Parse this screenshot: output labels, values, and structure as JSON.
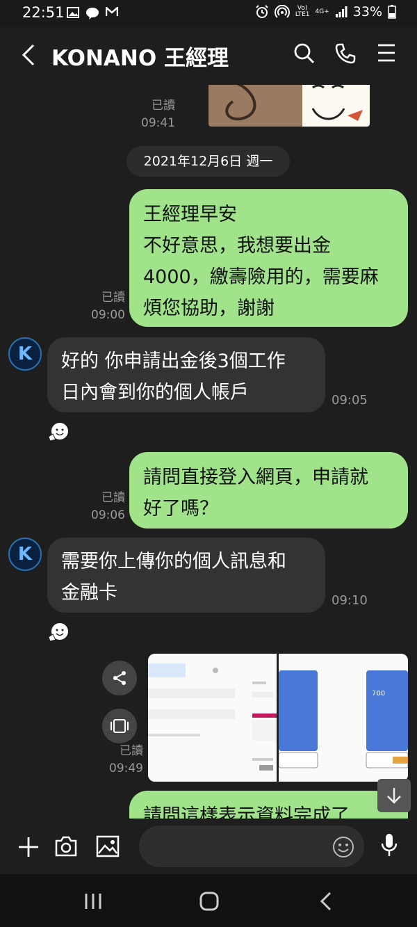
{
  "status_bar": {
    "time": "22:51",
    "volte": "Vo)",
    "lte_label": "LTE1",
    "network": "4G+",
    "battery": "33%"
  },
  "header": {
    "title": "KONANO 王經理",
    "icons": [
      "back-icon",
      "search-icon",
      "phone-icon",
      "menu-icon"
    ]
  },
  "chat": {
    "date_separator": "2021年12月6日 週一",
    "sticker_meta": {
      "read": "已讀",
      "time": "09:41"
    },
    "messages": [
      {
        "direction": "out",
        "lines": [
          "王經理早安",
          "不好意思，我想要出金",
          "4000，繳壽險用的，需要麻",
          "煩您協助，謝謝"
        ],
        "read": "已讀",
        "time": "09:00"
      },
      {
        "direction": "in",
        "avatar_letter": "K",
        "lines": [
          "好的 你申請出金後3個工作",
          "日內會到你的個人帳戶"
        ],
        "time": "09:05",
        "reaction": "smile-emoji"
      },
      {
        "direction": "out",
        "lines": [
          "請問直接登入網頁，申請就",
          "好了嗎？"
        ],
        "read": "已讀",
        "time": "09:06"
      },
      {
        "direction": "in",
        "avatar_letter": "K",
        "lines": [
          "需要你上傳你的個人訊息和",
          "金融卡"
        ],
        "time": "09:10",
        "reaction": "smile-emoji"
      },
      {
        "direction": "out",
        "type": "images",
        "read": "已讀",
        "time": "09:49",
        "image_text": "700"
      },
      {
        "direction": "out",
        "lines": [
          "請問這樣表示資料完成了"
        ]
      }
    ]
  },
  "input": {
    "placeholder": "",
    "icons": [
      "plus-icon",
      "camera-icon",
      "image-icon",
      "emoji-icon",
      "mic-icon"
    ]
  },
  "colors": {
    "outgoing_bubble": "#a0e38a",
    "incoming_bubble": "#333333",
    "background": "#1e1e1e"
  }
}
